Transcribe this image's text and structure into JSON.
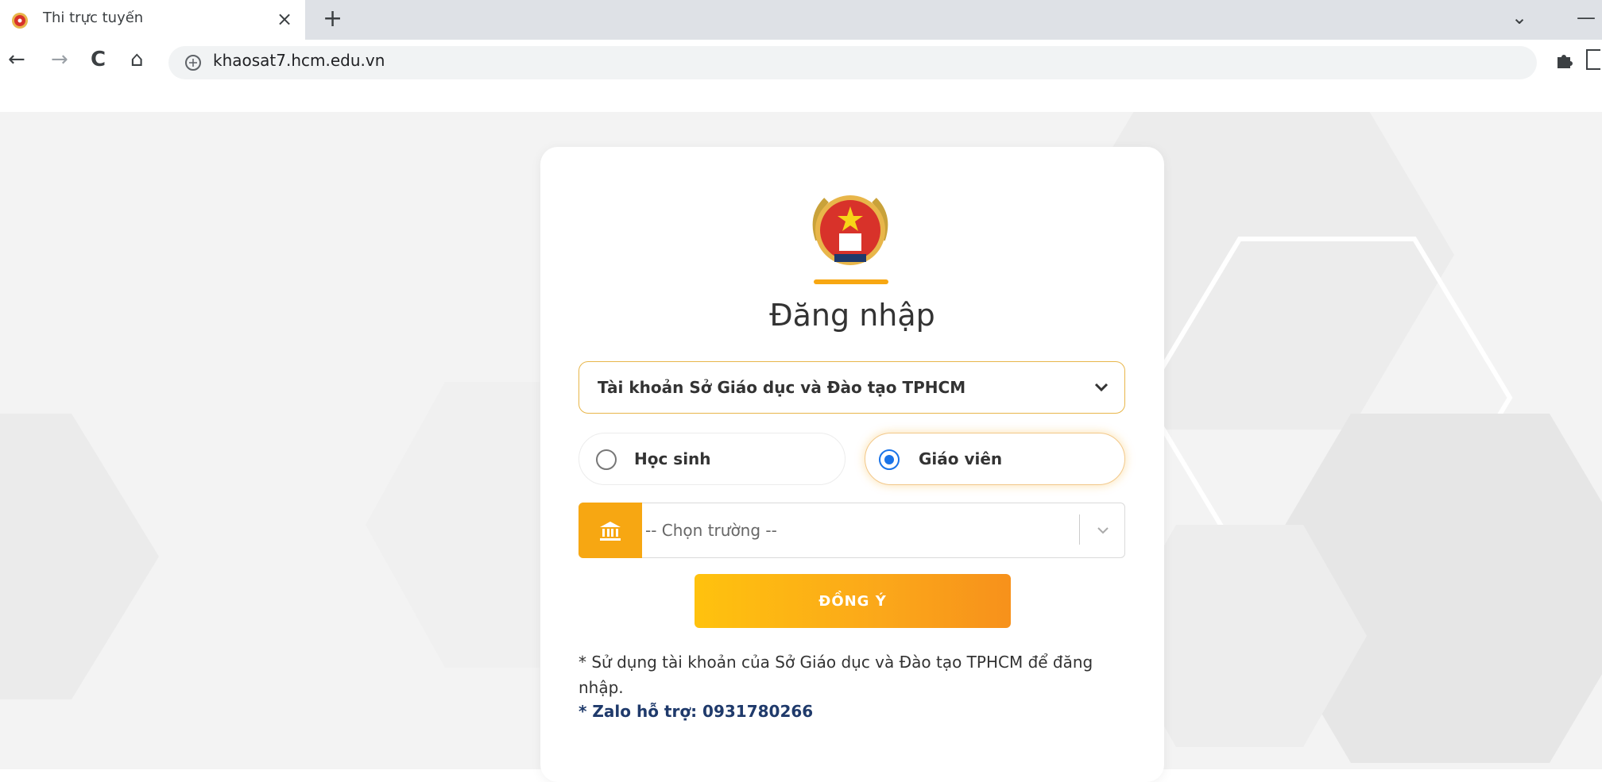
{
  "browser": {
    "tab_title": "Thi trực tuyến",
    "tab_close": "×",
    "new_tab": "+",
    "url": "khaosat7.hcm.edu.vn",
    "nav": {
      "back": "←",
      "forward": "→",
      "reload": "C",
      "home": "⌂"
    },
    "window_controls": {
      "dropdown": "⌄",
      "minimize": "—"
    },
    "extension_icon": "puzzle-icon"
  },
  "login": {
    "title": "Đăng nhập",
    "account_type": "Tài khoản Sở Giáo dục và Đào tạo TPHCM",
    "roles": [
      {
        "label": "Học sinh",
        "selected": false
      },
      {
        "label": "Giáo viên",
        "selected": true
      }
    ],
    "school_placeholder": "-- Chọn trường --",
    "submit_label": "ĐỒNG Ý",
    "note": "* Sử dụng tài khoản của Sở Giáo dục và Đào tạo TPHCM để đăng nhập.",
    "support": "* Zalo hỗ trợ: 0931780266"
  },
  "colors": {
    "accent": "#f7a712",
    "radio_selected": "#1a73e8",
    "support_text": "#1f3a6b"
  }
}
